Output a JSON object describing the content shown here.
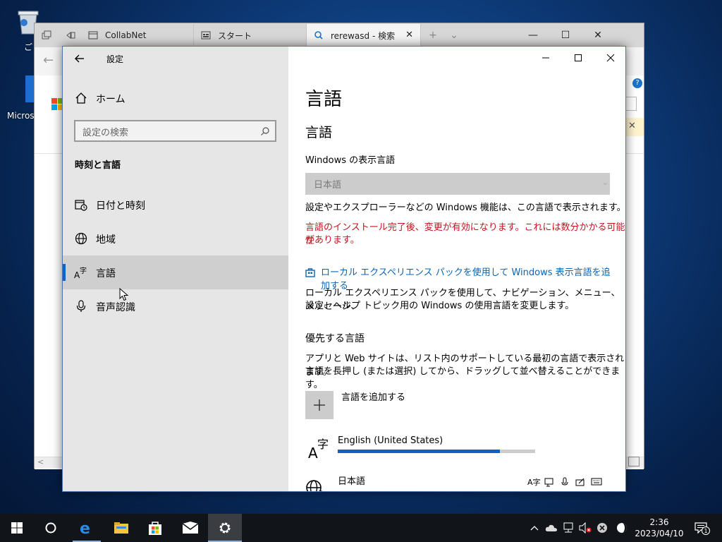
{
  "desktop": {
    "icons": [
      {
        "label": "ご"
      },
      {
        "label": "Micros"
      }
    ]
  },
  "edge": {
    "tabs": [
      {
        "label": "CollabNet"
      },
      {
        "label": "スタート"
      },
      {
        "label": "rerewasd - 検索"
      }
    ],
    "new_tab_symbol": "+",
    "minimize_symbol": "—",
    "maximize_symbol": "☐",
    "close_symbol": "✕"
  },
  "settings": {
    "window_title": "設定",
    "nav": {
      "home_label": "ホーム",
      "search_placeholder": "設定の検索",
      "section_title": "時刻と言語",
      "items": [
        {
          "label": "日付と時刻",
          "icon": "calendar-clock-icon"
        },
        {
          "label": "地域",
          "icon": "globe-icon"
        },
        {
          "label": "言語",
          "icon": "language-icon",
          "selected": true
        },
        {
          "label": "音声認識",
          "icon": "microphone-icon"
        }
      ]
    },
    "page": {
      "title": "言語",
      "section_language": "言語",
      "display_language_label": "Windows の表示言語",
      "display_language_value": "日本語",
      "display_language_desc": "設定やエクスプローラーなどの Windows 機能は、この言語で表示されます。",
      "restart_warning_line1": "言語のインストール完了後、変更が有効になります。これには数分かかる可能性",
      "restart_warning_line2": "があります。",
      "lep_link": "ローカル エクスペリエンス パックを使用して Windows 表示言語を追加する",
      "lep_desc_line1": "ローカル エクスペリエンス パックを使用して、ナビゲーション、メニュー、メッセージ、",
      "lep_desc_line2": "設定、ヘルプ トピック用の Windows の使用言語を変更します。",
      "preferred_title": "優先する言語",
      "preferred_desc_line1": "アプリと Web サイトは、リスト内のサポートしている最初の言語で表示されます。",
      "preferred_desc_line2": "言語を長押し (または選択) してから、ドラッグして並べ替えることができます。",
      "add_language_label": "言語を追加する",
      "languages": [
        {
          "name": "English (United States)",
          "progress": 0.82
        },
        {
          "name": "日本語"
        }
      ]
    },
    "accent_color": "#0a64c8",
    "warning_color": "#c4131f"
  },
  "taskbar": {
    "time": "2:36",
    "date": "2023/04/10",
    "notification_count": "1"
  }
}
